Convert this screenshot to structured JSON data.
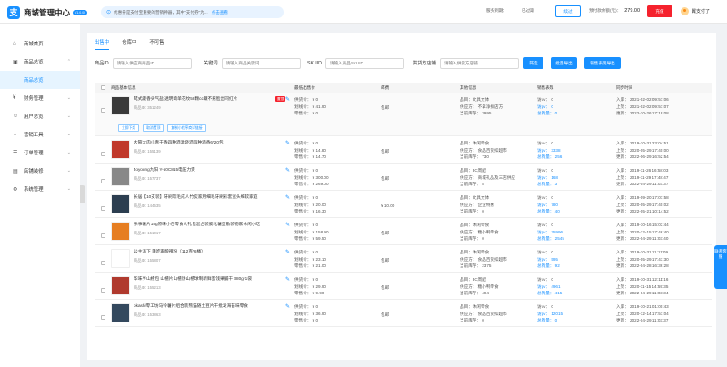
{
  "app": {
    "logo_char": "支",
    "title": "商城管理中心",
    "version": "V1.0.00"
  },
  "notice": {
    "text": "优惠券是支付宝重要的营销神器，其中\"支付券\"为...",
    "link": "点击查看"
  },
  "service": {
    "label": "服务到期：",
    "value": "已过期"
  },
  "renew_label": "续过",
  "balance": {
    "label": "预付款余额(元)：",
    "value": "279.00"
  },
  "charge_label": "充值",
  "user": {
    "name": "翼支付了"
  },
  "sidebar": {
    "items": [
      {
        "label": "商城首页",
        "icon": "home-icon"
      },
      {
        "label": "商品总览",
        "icon": "shop-icon",
        "open": true
      },
      {
        "label": "财务管理",
        "icon": "finance-icon"
      },
      {
        "label": "用户总览",
        "icon": "user-icon"
      },
      {
        "label": "营销工具",
        "icon": "marketing-icon"
      },
      {
        "label": "订单管理",
        "icon": "order-icon"
      },
      {
        "label": "店铺装修",
        "icon": "decorate-icon"
      },
      {
        "label": "系统管理",
        "icon": "settings-icon"
      }
    ],
    "sub_item": "商品总览"
  },
  "tabs": [
    "出售中",
    "仓库中",
    "不可售"
  ],
  "filters": [
    {
      "label": "商品ID",
      "placeholder": "请输入供应商商品ID"
    },
    {
      "label": "关键词",
      "placeholder": "请输入商品关键词"
    },
    {
      "label": "SKUID",
      "placeholder": "请输入商品SKUID"
    },
    {
      "label": "供货方店铺",
      "placeholder": "请输入供货方店铺"
    }
  ],
  "buttons": {
    "search": "筛选",
    "export": "批量导出",
    "export_on_sale": "销售表现导出"
  },
  "columns": [
    "商品基本信息",
    "最低出售价",
    "邮费",
    "其他信息",
    "销售表现",
    "同步时间"
  ],
  "row_actions": [
    "立即下架",
    "取消置顶",
    "复制小程序商详链接"
  ],
  "rows": [
    {
      "name": "梵式藏香头气盐 透明简单花纹58颗cc藏不惹脸出同红片",
      "id": "商品ID: 351249",
      "tag": "置顶",
      "supply": "供货价： ¥ 0",
      "suggest": "划线价： ¥ 41.90",
      "retail": "零售价： ¥ 0",
      "mail": "包邮",
      "cat": "品目：文具文体",
      "vendor": "供应方： 不拿净扣店方",
      "stock": "当前库存： 3995",
      "pv": "访uv： 0",
      "uv": "访pv： 0",
      "total": "总销量： 0",
      "t1": "入库： 2021-02-02 09:57:06",
      "t2": "上架： 2021-02-02 09:57:07",
      "t3": "更新： 2022-10-26 17:19:08",
      "thumb": "#3a3a3a"
    },
    {
      "name": "大碗大肉小青干香四种酒源烧酒四种酒香6*20包",
      "id": "商品ID: 155139",
      "tag": "",
      "supply": "供货价： ¥ 0",
      "suggest": "划线价： ¥ 14.80",
      "retail": "零售价： ¥ 14.70",
      "mail": "包邮",
      "cat": "品目：休闲零食",
      "vendor": "供应方： 食品百货扣超市",
      "stock": "当前库存： 730",
      "pv": "访uv： 0",
      "uv": "访pv： 3338",
      "total": "总销量： 256",
      "t1": "入库： 2019-10-31 23:04:51",
      "t2": "上架： 2020-05-29 17:40:00",
      "t3": "更新： 2022-06-29 16:52:54",
      "thumb": "#c0392b"
    },
    {
      "name": "Joyoung九阳 Y-50C815电压力煲",
      "id": "商品ID: 157737",
      "tag": "",
      "supply": "供货价： ¥ 0",
      "suggest": "划线价： ¥ 300.00",
      "retail": "零售价： ¥ 269.00",
      "mail": "包邮",
      "cat": "品目：3C周配",
      "vendor": "供应方： 商城礼品及三店供应",
      "stock": "当前库存： 8",
      "pv": "访uv： 0",
      "uv": "访pv： 168",
      "total": "总销量： 3",
      "t1": "入库： 2019-11-26 16:58:03",
      "t2": "上架： 2019-11-29 17:48:47",
      "t3": "更新： 2022-04-29 11:03:37",
      "thumb": "#888"
    },
    {
      "name": "长居【10支装】牙刷软毛成人竹炭家用细毛牙刷彩套宽头细软家庭",
      "id": "商品ID: 144535",
      "tag": "",
      "supply": "供货价： ¥ 0",
      "suggest": "划线价： ¥ 20.00",
      "retail": "零售价： ¥ 16.30",
      "mail": "¥ 10.00",
      "cat": "品目：文具文体",
      "vendor": "供应方： 企业特惠",
      "stock": "当前库存： 0",
      "pv": "访uv： 0",
      "uv": "访pv： 780",
      "total": "总销量： 40",
      "t1": "入库： 2019-09-20 17:07:58",
      "t2": "上架： 2020-05-29 17:40:02",
      "t3": "更新： 2022-05-21 10:14:52",
      "thumb": "#2c3e50"
    },
    {
      "name": "乐事薯片15g原味小包零食大礼包混合装膨化薯型散装物家休闲小吃",
      "id": "商品ID: 151017",
      "tag": "",
      "supply": "供货价： ¥ 0",
      "suggest": "划线价： ¥ 158.90",
      "retail": "零售价： ¥ 59.50",
      "mail": "包邮",
      "cat": "品目：休闲零食",
      "vendor": "供应方： 糖小鸭零食",
      "stock": "当前库存： 0",
      "pv": "访uv： 0",
      "uv": "访pv： 25996",
      "total": "总销量： 2545",
      "t1": "入库： 2019-10-16 15:03:44",
      "t2": "上架： 2020-12-15 17:46:40",
      "t3": "更新： 2022-04-29 11:03:40",
      "thumb": "#e67e22"
    },
    {
      "name": "公主派下 薄吃家酿辣粉（112克*6桶）",
      "id": "商品ID: 155807",
      "tag": "",
      "supply": "供货价： ¥ 0",
      "suggest": "划线价： ¥ 23.10",
      "retail": "零售价： ¥ 21.00",
      "mail": "包邮",
      "cat": "品目：休闲零食",
      "vendor": "供应方： 食品百货扣超市",
      "stock": "当前库存： 2375",
      "pv": "访uv： 0",
      "uv": "访pv： 595",
      "total": "总销量： 92",
      "t1": "入库： 2019-10-31 11:11:09",
      "t2": "上架： 2020-05-29 17:41:30",
      "t3": "更新： 2022-04-28 16:36:28",
      "thumb": "#fff"
    },
    {
      "name": "华味亨山楂包 山楂片山楂饼山楂球制新鲜蜜饯果脯干 380g*1袋",
      "id": "商品ID: 155213",
      "tag": "",
      "supply": "供货价： ¥ 0",
      "suggest": "划线价： ¥ 29.90",
      "retail": "零售价： ¥ 9.90",
      "mail": "包邮",
      "cat": "品目：3C周配",
      "vendor": "供应方： 糖小鸭零食",
      "stock": "当前库存： 494",
      "pv": "访uv： 0",
      "uv": "访pv： 4961",
      "total": "总销量： 415",
      "t1": "入库： 2019-10-31 12:11:16",
      "t2": "上架： 2020-11-15 14:59:35",
      "t3": "更新： 2022-04-29 11:03:34",
      "thumb": "#b03a2e"
    },
    {
      "name": "okashi零工坊马铃薯片组合装熊猫随土豆片干批发海苔味零食",
      "id": "商品ID: 153863",
      "tag": "",
      "supply": "供货价： ¥ 0",
      "suggest": "划线价： ¥ 36.90",
      "retail": "零售价： ¥ 0",
      "mail": "包邮",
      "cat": "品目：休闲零食",
      "vendor": "供应方： 食品百货扣超市",
      "stock": "当前库存： 0",
      "pv": "访uv： 0",
      "uv": "访pv： 12015",
      "total": "总销量： 0",
      "t1": "入库： 2019-10-21 01:00:43",
      "t2": "上架： 2020-12-14 17:51:04",
      "t3": "更新： 2022-04-29 11:03:37",
      "thumb": "#34495e"
    }
  ],
  "float": {
    "label": "联系客服"
  }
}
